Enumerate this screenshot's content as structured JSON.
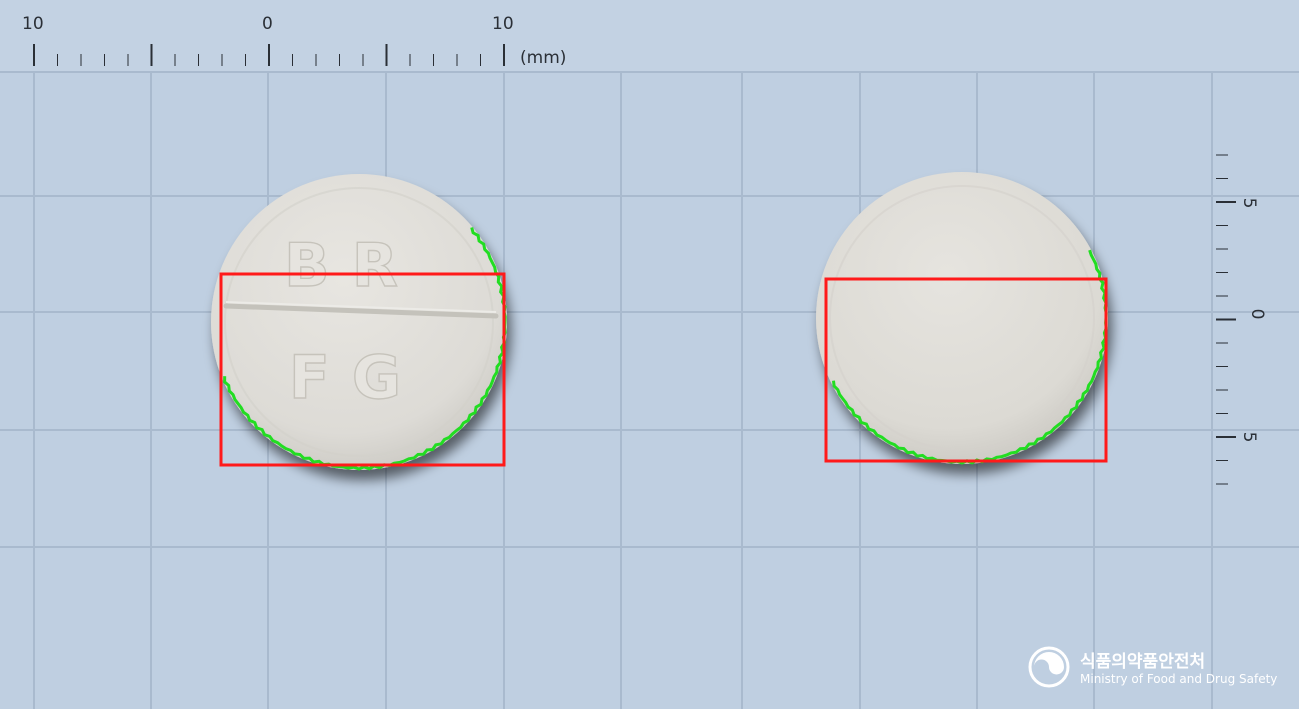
{
  "colors": {
    "background": "#bfcfe1",
    "grid_line": "#a9bace",
    "ruler_band": "#c3d2e3",
    "pill": "#dfddd8",
    "bounding_box": "#ff1a1a",
    "contour": "#22dd22",
    "text": "#2a2f36",
    "logo_text": "#ffffff"
  },
  "top_ruler": {
    "labels": [
      "10",
      "0",
      "10"
    ],
    "unit": "(mm)"
  },
  "right_ruler": {
    "labels": [
      "5",
      "0",
      "5"
    ]
  },
  "pills": [
    {
      "name": "pill-front",
      "imprint_top": "BR",
      "imprint_bottom": "FG",
      "score_line": true
    },
    {
      "name": "pill-back",
      "imprint_top": "",
      "imprint_bottom": "",
      "score_line": false
    }
  ],
  "logo": {
    "korean": "식품의약품안전처",
    "english": "Ministry of Food and Drug Safety",
    "icon": "mfds-emblem-icon"
  }
}
